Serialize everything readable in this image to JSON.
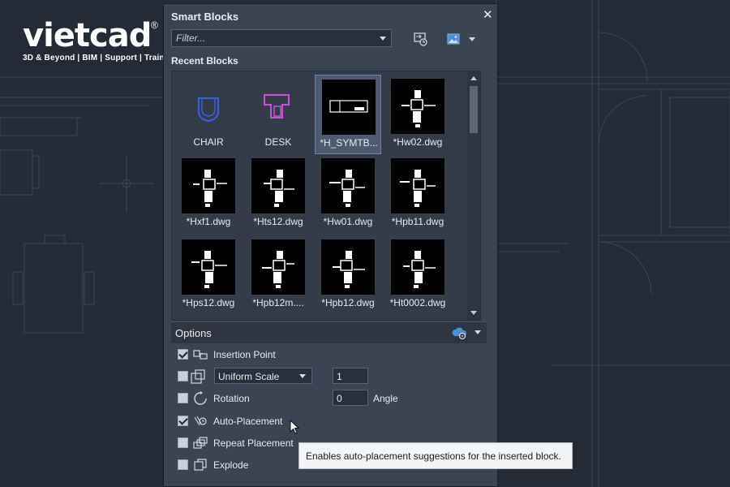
{
  "logo": {
    "brand": "vietcad",
    "registered_mark": "®",
    "tagline": "3D & Beyond | BIM | Support | Training"
  },
  "palette": {
    "title": "Smart Blocks",
    "close_icon": "close-icon",
    "filter_placeholder": "Filter...",
    "toolbar_icons": [
      "refresh-settings-icon",
      "image-view-icon",
      "chevron-down-icon"
    ],
    "recent_label": "Recent Blocks",
    "blocks": [
      {
        "label": "CHAIR",
        "thumb": "chair-icon",
        "selected": false
      },
      {
        "label": "DESK",
        "thumb": "desk-icon",
        "selected": false
      },
      {
        "label": "*H_SYMTB...",
        "thumb": "drawing-thumbnail",
        "selected": true
      },
      {
        "label": "*Hw02.dwg",
        "thumb": "drawing-thumbnail",
        "selected": false
      },
      {
        "label": "*Hxf1.dwg",
        "thumb": "drawing-thumbnail",
        "selected": false
      },
      {
        "label": "*Hts12.dwg",
        "thumb": "drawing-thumbnail",
        "selected": false
      },
      {
        "label": "*Hw01.dwg",
        "thumb": "drawing-thumbnail",
        "selected": false
      },
      {
        "label": "*Hpb11.dwg",
        "thumb": "drawing-thumbnail",
        "selected": false
      },
      {
        "label": "*Hps12.dwg",
        "thumb": "drawing-thumbnail",
        "selected": false
      },
      {
        "label": "*Hpb12m....",
        "thumb": "drawing-thumbnail",
        "selected": false
      },
      {
        "label": "*Hpb12.dwg",
        "thumb": "drawing-thumbnail",
        "selected": false
      },
      {
        "label": "*Ht0002.dwg",
        "thumb": "drawing-thumbnail",
        "selected": false
      }
    ],
    "options": {
      "title": "Options",
      "header_icons": [
        "cloud-settings-icon",
        "chevron-down-icon"
      ],
      "insertion_point": {
        "label": "Insertion Point",
        "checked": true,
        "icon": "insertion-point-icon"
      },
      "scale": {
        "checked": false,
        "icon": "scale-icon",
        "mode": "Uniform Scale",
        "value": "1"
      },
      "rotation": {
        "label": "Rotation",
        "checked": false,
        "icon": "rotation-icon",
        "value": "0",
        "unit_label": "Angle"
      },
      "auto_placement": {
        "label": "Auto-Placement",
        "checked": true,
        "icon": "auto-placement-icon"
      },
      "repeat_placement": {
        "label": "Repeat Placement",
        "checked": false,
        "icon": "repeat-placement-icon"
      },
      "explode": {
        "label": "Explode",
        "checked": false,
        "icon": "explode-icon"
      }
    }
  },
  "tooltip": {
    "text": "Enables auto-placement suggestions for the inserted block."
  },
  "colors": {
    "background": "#242a36",
    "palette_bg": "#3b4453",
    "selected_tile": "#4d5a70",
    "chair_icon": "#3a5fe0",
    "desk_icon": "#c84fd8"
  }
}
